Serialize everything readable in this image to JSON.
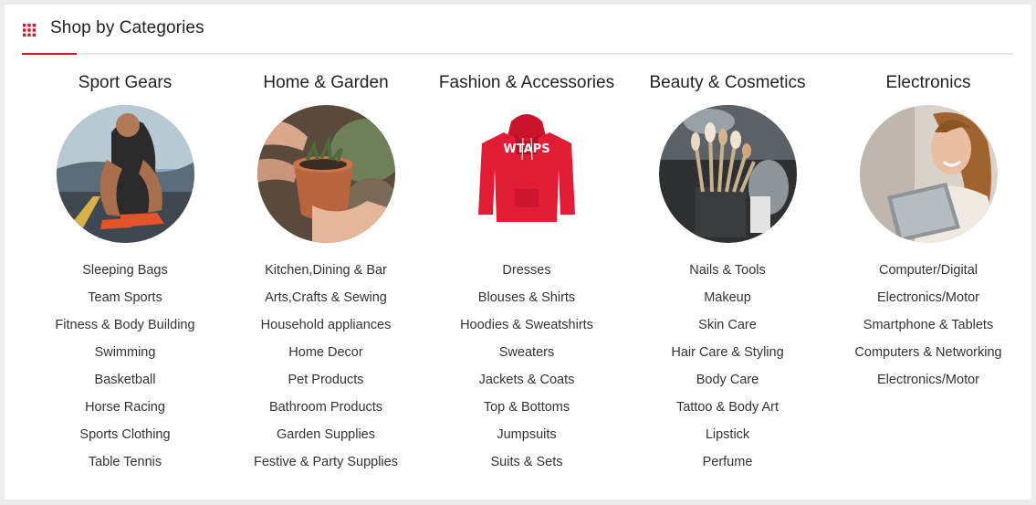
{
  "header": {
    "title": "Shop by Categories",
    "icon": "grid-dots-icon",
    "accent_color": "#d7182a"
  },
  "categories": [
    {
      "title": "Sport Gears",
      "image": "runner-tying-shoe-photo",
      "links": [
        "Sleeping Bags",
        "Team Sports",
        "Fitness & Body Building",
        "Swimming",
        "Basketball",
        "Horse Racing",
        "Sports Clothing",
        "Table Tennis"
      ]
    },
    {
      "title": "Home & Garden",
      "image": "potted-plant-hands-photo",
      "links": [
        "Kitchen,Dining & Bar",
        "Arts,Crafts & Sewing",
        "Household appliances",
        "Home Decor",
        "Pet Products",
        "Bathroom Products",
        "Garden Supplies",
        "Festive & Party Supplies"
      ]
    },
    {
      "title": "Fashion & Accessories",
      "image": "red-hoodie-photo",
      "hoodie_print": "WTAPS",
      "links": [
        "Dresses",
        "Blouses & Shirts",
        "Hoodies & Sweatshirts",
        "Sweaters",
        "Jackets & Coats",
        "Top & Bottoms",
        "Jumpsuits",
        "Suits & Sets"
      ]
    },
    {
      "title": "Beauty & Cosmetics",
      "image": "makeup-brushes-photo",
      "links": [
        "Nails & Tools",
        "Makeup",
        "Skin Care",
        "Hair Care & Styling",
        "Body Care",
        "Tattoo & Body Art",
        "Lipstick",
        "Perfume"
      ]
    },
    {
      "title": "Electronics",
      "image": "woman-with-tablet-photo",
      "links": [
        "Computer/Digital",
        "Electronics/Motor",
        "Smartphone & Tablets",
        "Computers & Networking",
        "Electronics/Motor"
      ]
    }
  ]
}
